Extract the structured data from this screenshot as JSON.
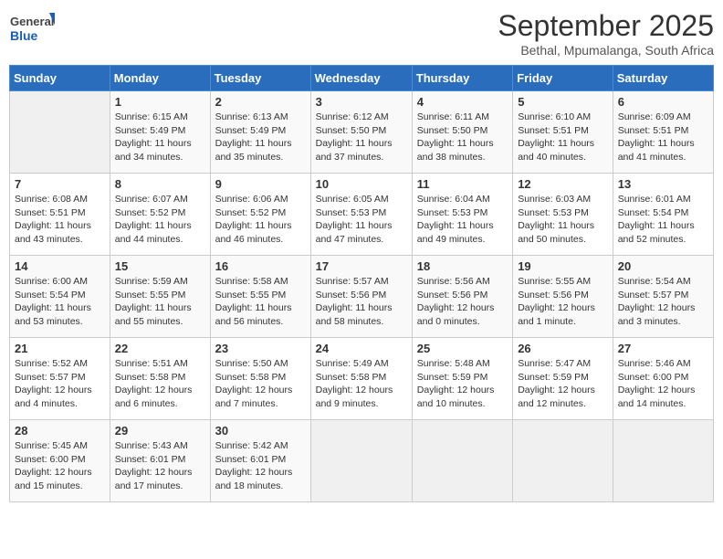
{
  "logo": {
    "general": "General",
    "blue": "Blue"
  },
  "title": "September 2025",
  "subtitle": "Bethal, Mpumalanga, South Africa",
  "days_of_week": [
    "Sunday",
    "Monday",
    "Tuesday",
    "Wednesday",
    "Thursday",
    "Friday",
    "Saturday"
  ],
  "weeks": [
    [
      {
        "day": "",
        "info": ""
      },
      {
        "day": "1",
        "info": "Sunrise: 6:15 AM\nSunset: 5:49 PM\nDaylight: 11 hours\nand 34 minutes."
      },
      {
        "day": "2",
        "info": "Sunrise: 6:13 AM\nSunset: 5:49 PM\nDaylight: 11 hours\nand 35 minutes."
      },
      {
        "day": "3",
        "info": "Sunrise: 6:12 AM\nSunset: 5:50 PM\nDaylight: 11 hours\nand 37 minutes."
      },
      {
        "day": "4",
        "info": "Sunrise: 6:11 AM\nSunset: 5:50 PM\nDaylight: 11 hours\nand 38 minutes."
      },
      {
        "day": "5",
        "info": "Sunrise: 6:10 AM\nSunset: 5:51 PM\nDaylight: 11 hours\nand 40 minutes."
      },
      {
        "day": "6",
        "info": "Sunrise: 6:09 AM\nSunset: 5:51 PM\nDaylight: 11 hours\nand 41 minutes."
      }
    ],
    [
      {
        "day": "7",
        "info": "Sunrise: 6:08 AM\nSunset: 5:51 PM\nDaylight: 11 hours\nand 43 minutes."
      },
      {
        "day": "8",
        "info": "Sunrise: 6:07 AM\nSunset: 5:52 PM\nDaylight: 11 hours\nand 44 minutes."
      },
      {
        "day": "9",
        "info": "Sunrise: 6:06 AM\nSunset: 5:52 PM\nDaylight: 11 hours\nand 46 minutes."
      },
      {
        "day": "10",
        "info": "Sunrise: 6:05 AM\nSunset: 5:53 PM\nDaylight: 11 hours\nand 47 minutes."
      },
      {
        "day": "11",
        "info": "Sunrise: 6:04 AM\nSunset: 5:53 PM\nDaylight: 11 hours\nand 49 minutes."
      },
      {
        "day": "12",
        "info": "Sunrise: 6:03 AM\nSunset: 5:53 PM\nDaylight: 11 hours\nand 50 minutes."
      },
      {
        "day": "13",
        "info": "Sunrise: 6:01 AM\nSunset: 5:54 PM\nDaylight: 11 hours\nand 52 minutes."
      }
    ],
    [
      {
        "day": "14",
        "info": "Sunrise: 6:00 AM\nSunset: 5:54 PM\nDaylight: 11 hours\nand 53 minutes."
      },
      {
        "day": "15",
        "info": "Sunrise: 5:59 AM\nSunset: 5:55 PM\nDaylight: 11 hours\nand 55 minutes."
      },
      {
        "day": "16",
        "info": "Sunrise: 5:58 AM\nSunset: 5:55 PM\nDaylight: 11 hours\nand 56 minutes."
      },
      {
        "day": "17",
        "info": "Sunrise: 5:57 AM\nSunset: 5:56 PM\nDaylight: 11 hours\nand 58 minutes."
      },
      {
        "day": "18",
        "info": "Sunrise: 5:56 AM\nSunset: 5:56 PM\nDaylight: 12 hours\nand 0 minutes."
      },
      {
        "day": "19",
        "info": "Sunrise: 5:55 AM\nSunset: 5:56 PM\nDaylight: 12 hours\nand 1 minute."
      },
      {
        "day": "20",
        "info": "Sunrise: 5:54 AM\nSunset: 5:57 PM\nDaylight: 12 hours\nand 3 minutes."
      }
    ],
    [
      {
        "day": "21",
        "info": "Sunrise: 5:52 AM\nSunset: 5:57 PM\nDaylight: 12 hours\nand 4 minutes."
      },
      {
        "day": "22",
        "info": "Sunrise: 5:51 AM\nSunset: 5:58 PM\nDaylight: 12 hours\nand 6 minutes."
      },
      {
        "day": "23",
        "info": "Sunrise: 5:50 AM\nSunset: 5:58 PM\nDaylight: 12 hours\nand 7 minutes."
      },
      {
        "day": "24",
        "info": "Sunrise: 5:49 AM\nSunset: 5:58 PM\nDaylight: 12 hours\nand 9 minutes."
      },
      {
        "day": "25",
        "info": "Sunrise: 5:48 AM\nSunset: 5:59 PM\nDaylight: 12 hours\nand 10 minutes."
      },
      {
        "day": "26",
        "info": "Sunrise: 5:47 AM\nSunset: 5:59 PM\nDaylight: 12 hours\nand 12 minutes."
      },
      {
        "day": "27",
        "info": "Sunrise: 5:46 AM\nSunset: 6:00 PM\nDaylight: 12 hours\nand 14 minutes."
      }
    ],
    [
      {
        "day": "28",
        "info": "Sunrise: 5:45 AM\nSunset: 6:00 PM\nDaylight: 12 hours\nand 15 minutes."
      },
      {
        "day": "29",
        "info": "Sunrise: 5:43 AM\nSunset: 6:01 PM\nDaylight: 12 hours\nand 17 minutes."
      },
      {
        "day": "30",
        "info": "Sunrise: 5:42 AM\nSunset: 6:01 PM\nDaylight: 12 hours\nand 18 minutes."
      },
      {
        "day": "",
        "info": ""
      },
      {
        "day": "",
        "info": ""
      },
      {
        "day": "",
        "info": ""
      },
      {
        "day": "",
        "info": ""
      }
    ]
  ]
}
